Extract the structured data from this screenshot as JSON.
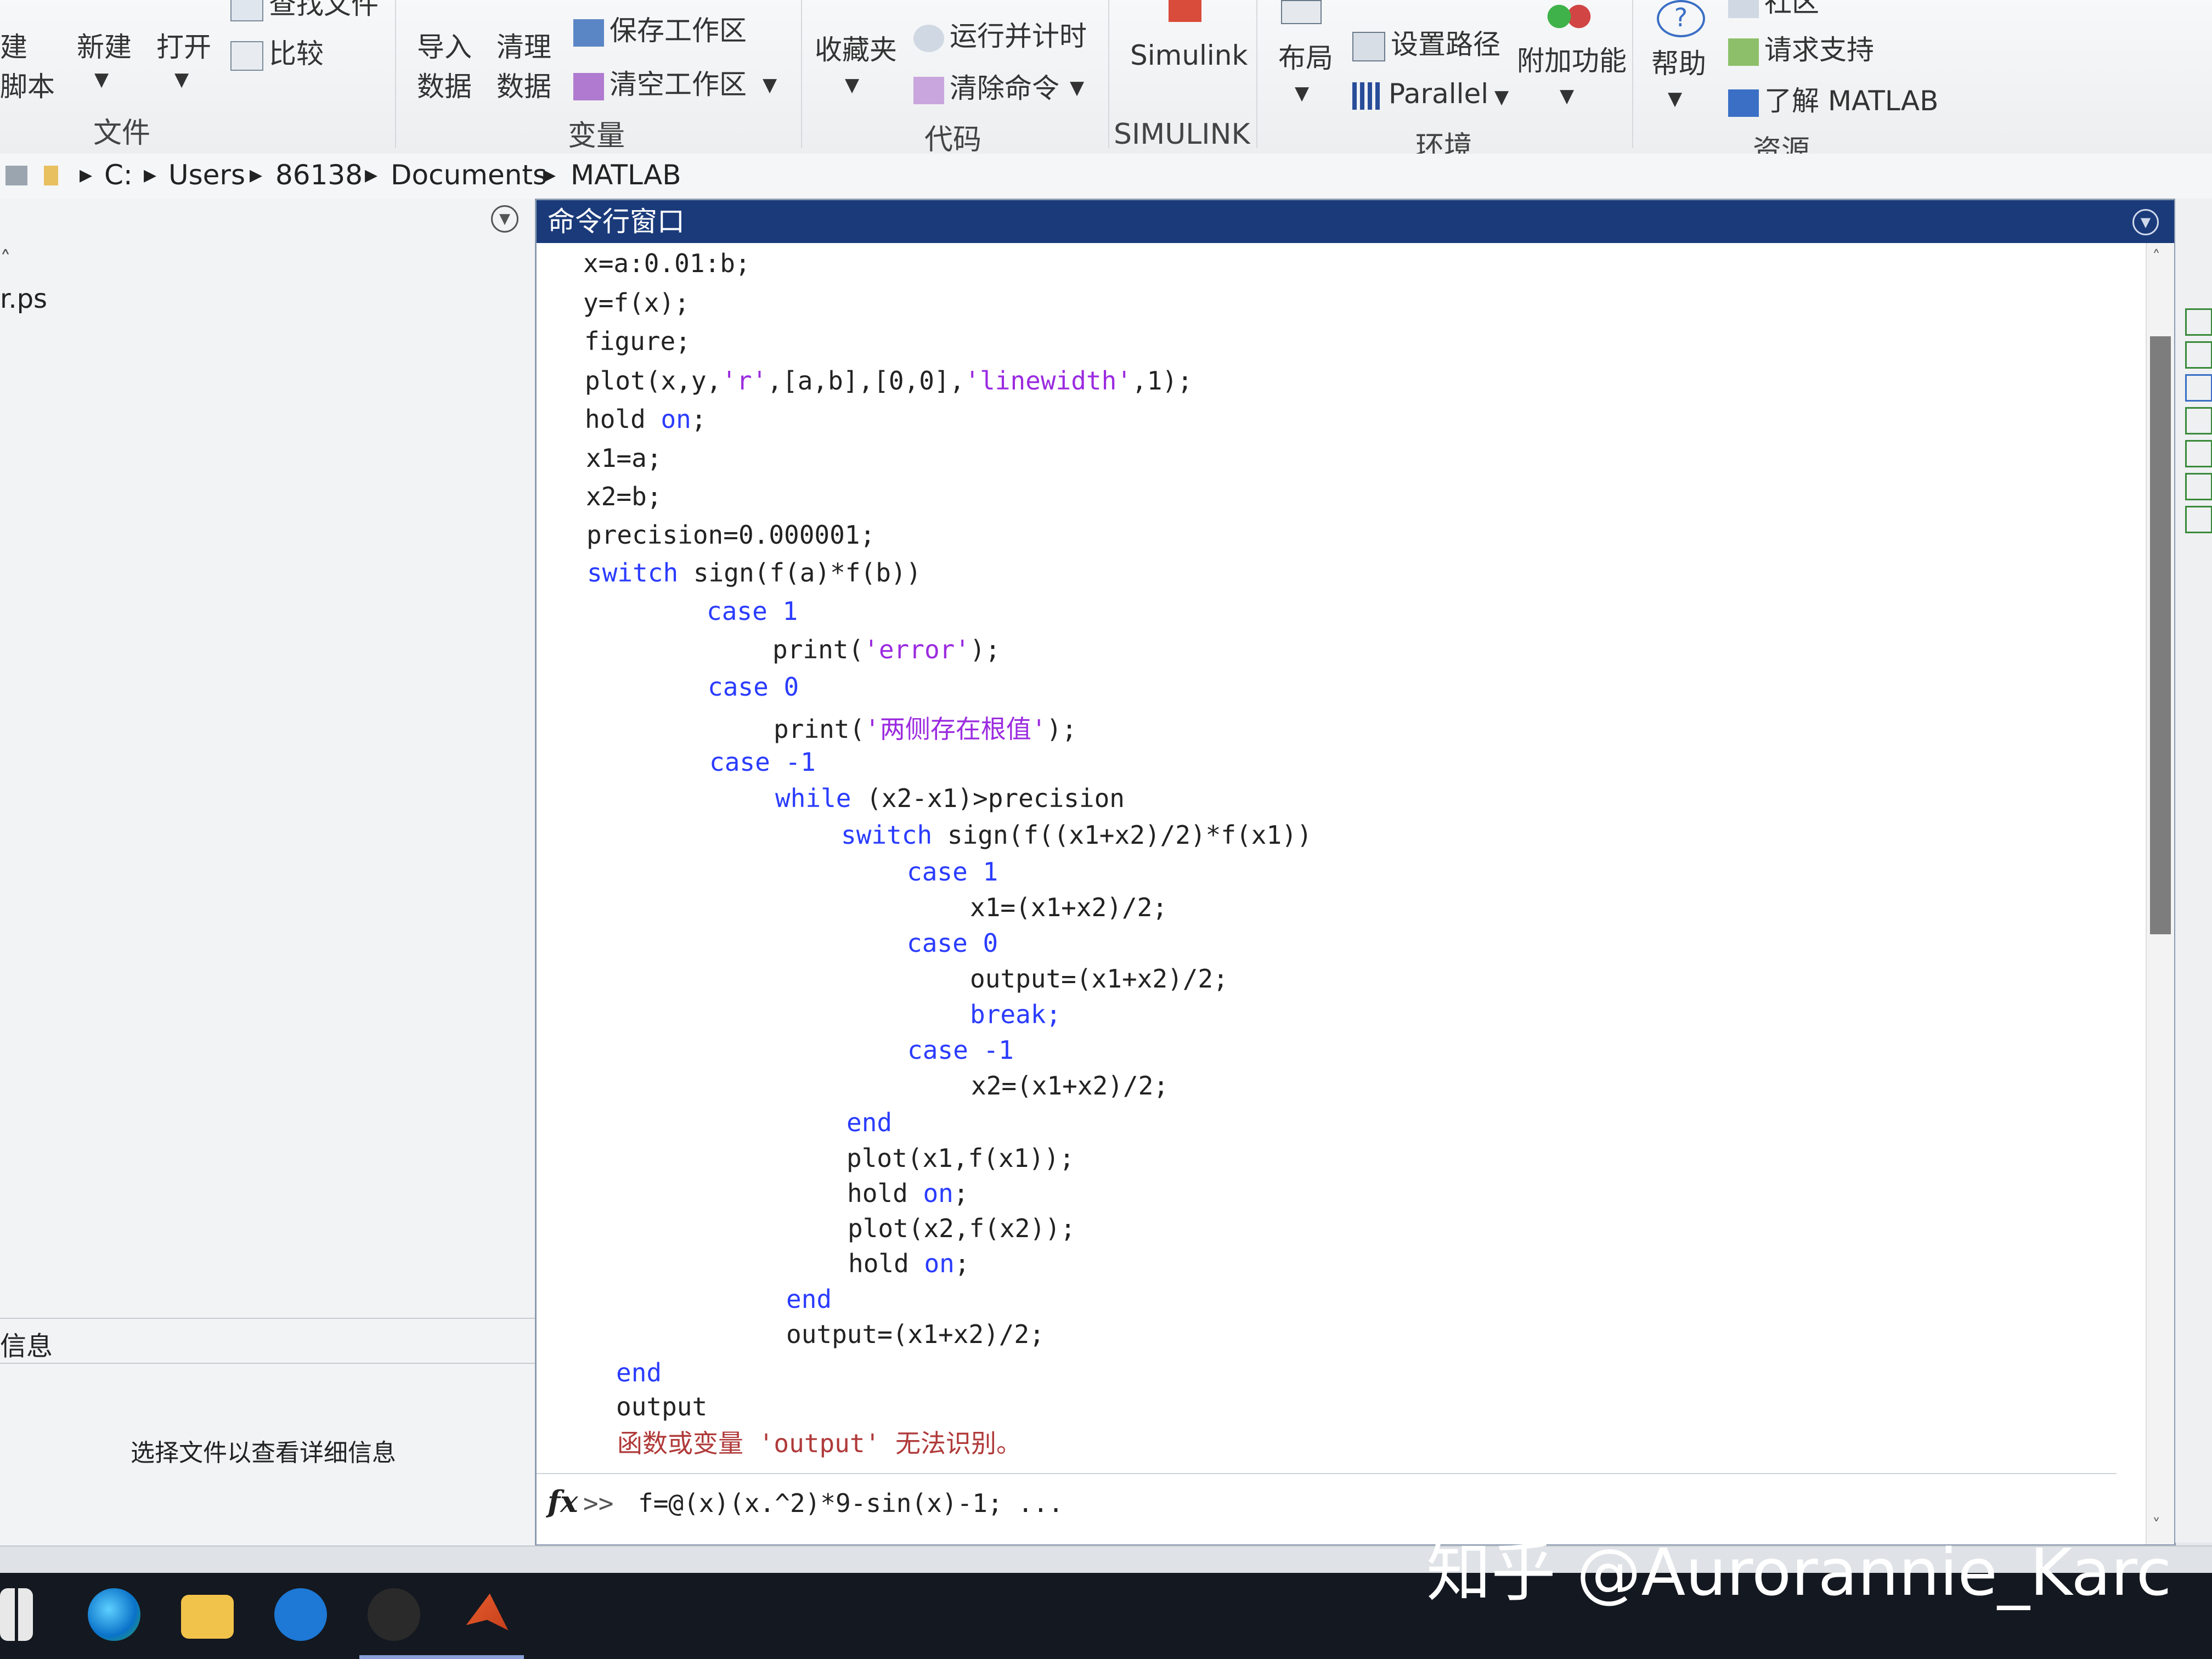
{
  "ribbon": {
    "file_section": "文件",
    "variable_section": "变量",
    "code_section": "代码",
    "simulink_section": "SIMULINK",
    "env_section": "环境",
    "resource_section": "资源",
    "new_script_line1": "建",
    "new_script_line2": "脚本",
    "new_label": "新建",
    "open_label": "打开",
    "find_files_label": "查找文件",
    "compare_label": "比较",
    "import_line1": "导入",
    "import_line2": "数据",
    "clean_line1": "清理",
    "clean_line2": "数据",
    "save_workspace_label": "保存工作区",
    "clear_workspace_label": "清空工作区",
    "favorites_label": "收藏夹",
    "run_time_label": "运行并计时",
    "clear_commands_label": "清除命令",
    "simulink_label": "Simulink",
    "layout_label": "布局",
    "set_path_label": "设置路径",
    "parallel_label": "Parallel",
    "addons_label": "附加功能",
    "help_label": "帮助",
    "community_label": "社区",
    "request_support_label": "请求支持",
    "learn_matlab_label": "了解 MATLAB"
  },
  "address": {
    "segments": [
      "C:",
      "Users",
      "86138",
      "Documents",
      "MATLAB"
    ]
  },
  "left_panel": {
    "file_item": "r.ps",
    "details_header": "信息",
    "details_hint": "选择文件以查看详细信息"
  },
  "command_window": {
    "title": "命令行窗口",
    "lines": [
      "x=a:0.01:b;",
      "y=f(x);",
      "figure;",
      "plot(x,y,'r',[a,b],[0,0],'linewidth',1);",
      "hold on;",
      "x1=a;",
      "x2=b;",
      "precision=0.000001;",
      "switch sign(f(a)*f(b))",
      "case 1",
      "print('error');",
      "case 0",
      "print('两侧存在根值');",
      "case -1",
      "while (x2-x1)>precision",
      "switch sign(f((x1+x2)/2)*f(x1))",
      "case 1",
      "x1=(x1+x2)/2;",
      "case 0",
      "output=(x1+x2)/2;",
      "break;",
      "case -1",
      "x2=(x1+x2)/2;",
      "end",
      "plot(x1,f(x1));",
      "hold on;",
      "plot(x2,f(x2));",
      "hold on;",
      "end",
      "output=(x1+x2)/2;",
      "end",
      "output",
      "函数或变量 'output' 无法识别。"
    ],
    "prompt_symbol": "fx",
    "prompt_chevrons": ">>",
    "prompt_input": "f=@(x)(x.^2)*9-sin(x)-1; ..."
  },
  "watermark": "知乎 @Aurorannie_Karc",
  "colors": {
    "keyword": "#2a3cff",
    "string": "#9b2be0",
    "error": "#b03a3a",
    "title_bar": "#1a3a7a"
  },
  "icons": [
    "new-script-icon",
    "open-icon",
    "find-files-icon",
    "compare-icon",
    "import-data-icon",
    "clean-data-icon",
    "save-workspace-icon",
    "clear-workspace-icon",
    "favorites-icon",
    "run-time-icon",
    "clear-commands-icon",
    "simulink-icon",
    "layout-icon",
    "set-path-icon",
    "parallel-icon",
    "addons-icon",
    "help-icon",
    "community-icon",
    "request-support-icon",
    "learn-matlab-icon",
    "windows-start-icon",
    "edge-icon",
    "file-explorer-icon",
    "ie-icon",
    "matlab-icon"
  ]
}
